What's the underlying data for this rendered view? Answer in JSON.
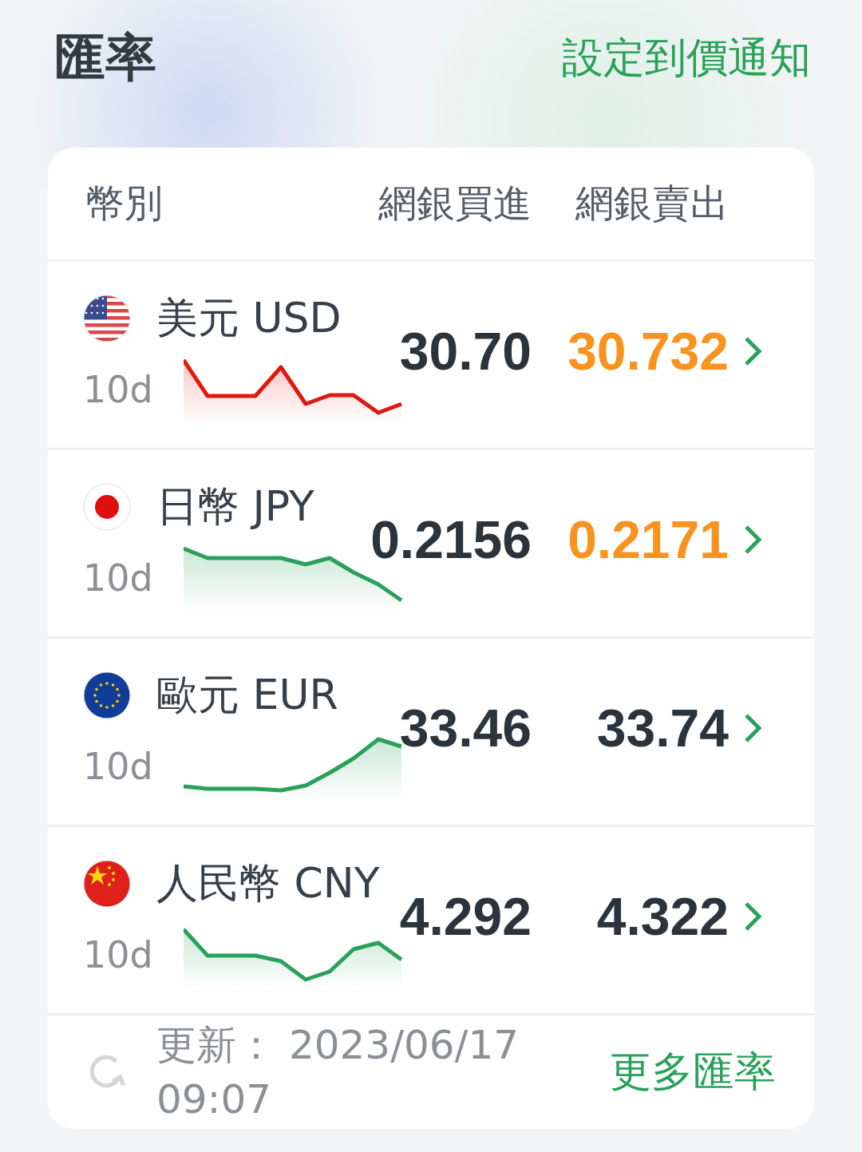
{
  "title": "匯率",
  "alert_link": "設定到價通知",
  "columns": [
    "幣別",
    "網銀買進",
    "網銀賣出"
  ],
  "rows": [
    {
      "name": "美元 USD",
      "period": "10d",
      "color": "#dd1a10",
      "buy": "30.70",
      "sell": "30.732",
      "highlighted": true
    },
    {
      "name": "日幣 JPY",
      "period": "10d",
      "color": "#2aa15a",
      "buy": "0.2156",
      "sell": "0.2171",
      "highlighted": true
    },
    {
      "name": "歐元 EUR",
      "period": "10d",
      "color": "#2aa15a",
      "buy": "33.46",
      "sell": "33.74",
      "highlighted": false
    },
    {
      "name": "人民幣 CNY",
      "period": "10d",
      "color": "#2aa15a",
      "buy": "4.292",
      "sell": "4.322",
      "highlighted": false
    }
  ],
  "footer": {
    "updated": "更新： 2023/06/17 09:07",
    "more_link": "更多匯率"
  }
}
